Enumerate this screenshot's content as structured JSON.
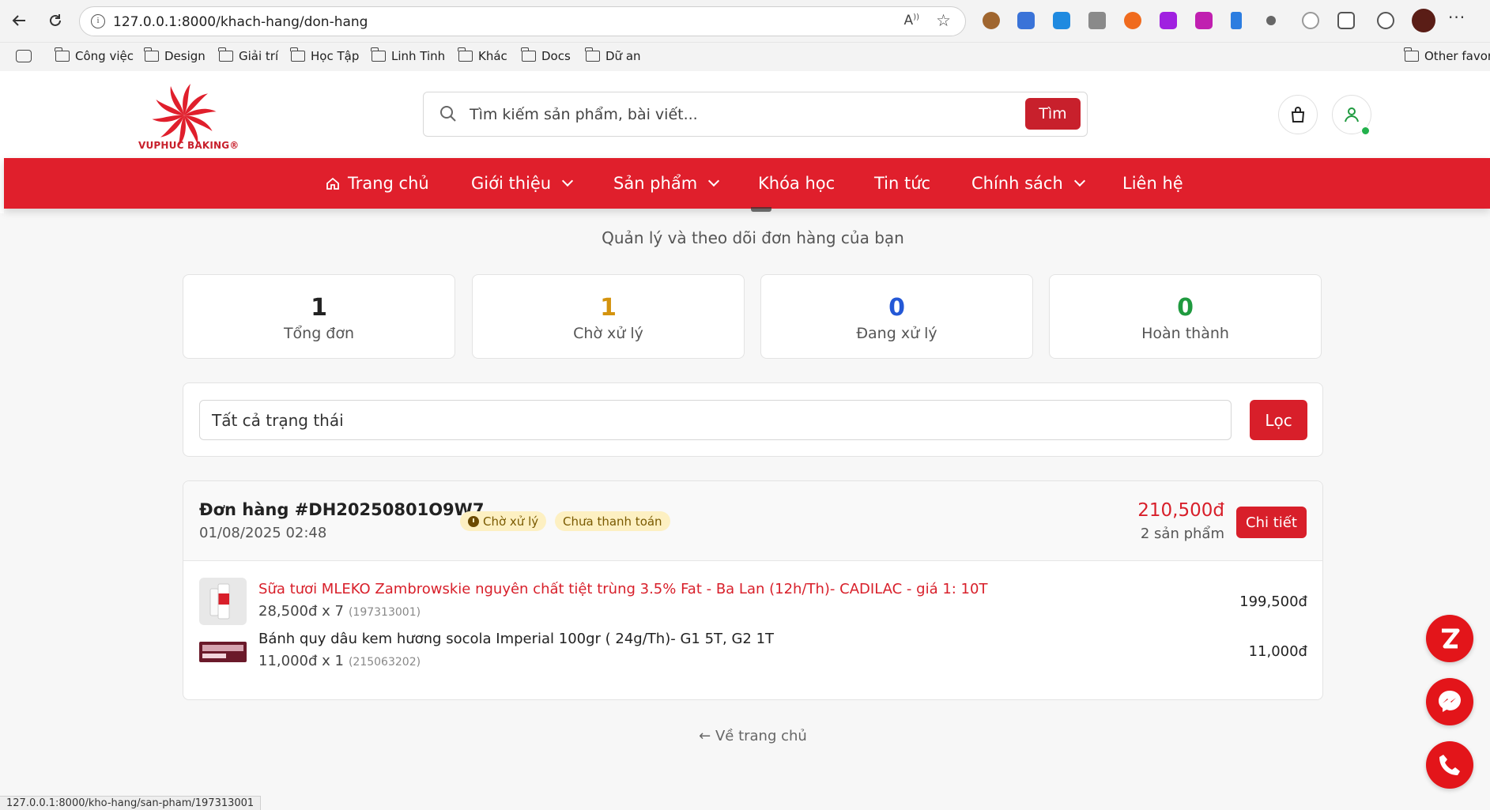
{
  "browser": {
    "url": "127.0.0.1:8000/khach-hang/don-hang",
    "read_aloud_label": "Aᵮ",
    "bookmarks": [
      "Công việc",
      "Design",
      "Giải trí",
      "Học Tập",
      "Linh Tinh",
      "Khác",
      "Docs",
      "Dữ an"
    ],
    "other_bookmarks": "Other favorit",
    "status_url": "127.0.0.1:8000/kho-hang/san-pham/197313001"
  },
  "site": {
    "logo_text": "VUPHUC BAKING®",
    "search_placeholder": "Tìm kiếm sản phẩm, bài viết...",
    "search_button": "Tìm",
    "brand_color": "#e01f2c",
    "nav": [
      {
        "label": "Trang chủ",
        "icon": "home-icon"
      },
      {
        "label": "Giới thiệu",
        "dropdown": true
      },
      {
        "label": "Sản phẩm",
        "dropdown": true
      },
      {
        "label": "Khóa học"
      },
      {
        "label": "Tin tức"
      },
      {
        "label": "Chính sách",
        "dropdown": true
      },
      {
        "label": "Liên hệ"
      }
    ]
  },
  "page": {
    "subtitle": "Quản lý và theo dõi đơn hàng của bạn",
    "stats": [
      {
        "value": "1",
        "label": "Tổng đơn",
        "color": "#222222"
      },
      {
        "value": "1",
        "label": "Chờ xử lý",
        "color": "#d4930e"
      },
      {
        "value": "0",
        "label": "Đang xử lý",
        "color": "#2458d6"
      },
      {
        "value": "0",
        "label": "Hoàn thành",
        "color": "#1f9a3f"
      }
    ],
    "filter": {
      "selected": "Tất cả trạng thái",
      "button": "Lọc"
    },
    "order": {
      "code": "Đơn hàng #DH20250801O9W7",
      "date": "01/08/2025 02:48",
      "status_badge": "Chờ xử lý",
      "payment_badge": "Chưa thanh toán",
      "total": "210,500đ",
      "item_count": "2 sản phẩm",
      "detail_button": "Chi tiết",
      "items": [
        {
          "name": "Sữa tươi MLEKO Zambrowskie nguyên chất tiệt trùng 3.5% Fat - Ba Lan (12h/Th)- CADILAC - giá 1: 10T",
          "qty": "28,500đ x 7",
          "sku": "(197313001)",
          "price": "199,500đ",
          "name_color": "#d81f2a"
        },
        {
          "name": "Bánh quy dâu kem hương socola Imperial 100gr ( 24g/Th)- G1 5T, G2 1T",
          "qty": "11,000đ x 1",
          "sku": "(215063202)",
          "price": "11,000đ",
          "name_color": "#222222"
        }
      ]
    },
    "back_link": "← Về trang chủ"
  }
}
